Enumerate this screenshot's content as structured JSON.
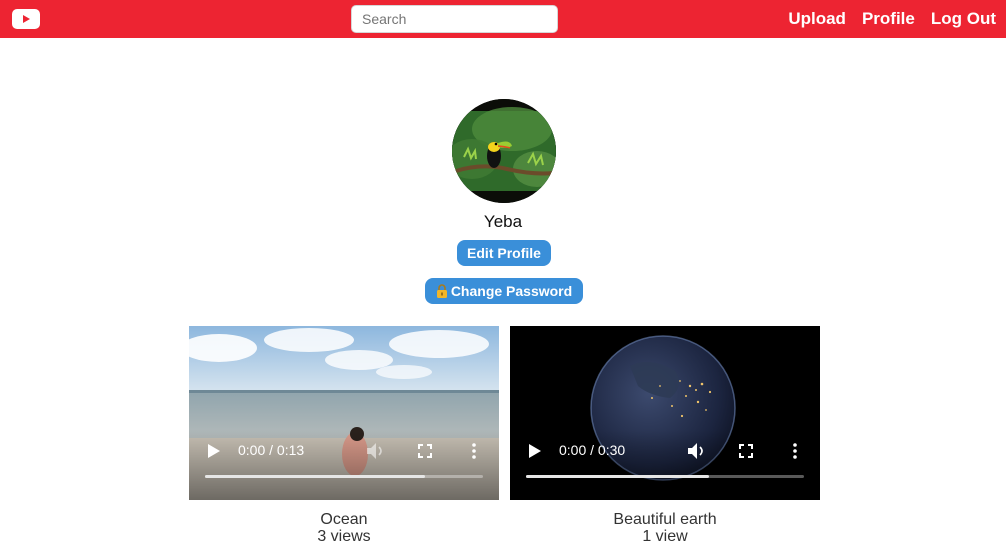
{
  "nav": {
    "logo_icon": "youtube-play-icon",
    "search_placeholder": "Search",
    "links": [
      "Upload",
      "Profile",
      "Log Out"
    ]
  },
  "profile": {
    "username": "Yeba",
    "edit_label": "Edit Profile",
    "password_label": "Change Password",
    "password_icon": "lock-icon"
  },
  "videos": [
    {
      "title": "Ocean",
      "views": "3 views",
      "time": "0:00 / 0:13",
      "progress": 0.79,
      "muted": true
    },
    {
      "title": "Beautiful earth",
      "views": "1 view",
      "time": "0:00 / 0:30",
      "progress": 0.66,
      "muted": false
    }
  ],
  "colors": {
    "brand": "#ed2432",
    "button": "#3a8fd9"
  }
}
